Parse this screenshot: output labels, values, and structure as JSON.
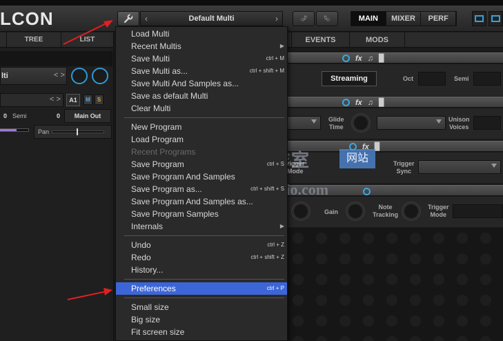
{
  "app": {
    "logo": "LCON",
    "multi_name": "Default Multi",
    "view_tabs": [
      "MAIN",
      "MIXER",
      "PERF"
    ],
    "active_view": "MAIN"
  },
  "left": {
    "tabs": [
      "",
      "TREE",
      "LIST"
    ],
    "program_name": "lti",
    "arrows": "< >",
    "part": "A1",
    "mute": "M",
    "solo": "S",
    "semi_value": "0",
    "semi_label": "Semi",
    "semi_value2": "0",
    "output": "Main Out",
    "pan_label": "Pan",
    "volume_level": 0.57
  },
  "right": {
    "tabs": [
      "EVENTS",
      "MODS"
    ],
    "streaming": "Streaming",
    "oct": "Oct",
    "semi": "Semi",
    "glide": "Glide\nTime",
    "unison": "Unison\nVoices",
    "trigger_mode": "rigger\nMode",
    "trigger_sync": "Trigger\nSync",
    "gain": "Gain",
    "note_tracking": "Note\nTracking",
    "trigger_mode2": "Trigger\nMode",
    "mode_clipped": "Mode",
    "accent_color": "#2f9ad8"
  },
  "menu": {
    "items": [
      {
        "label": "Load Multi",
        "shortcut": ""
      },
      {
        "label": "Recent Multis",
        "shortcut": "",
        "submenu": true
      },
      {
        "label": "Save Multi",
        "shortcut": "ctrl + M"
      },
      {
        "label": "Save Multi as...",
        "shortcut": "ctrl + shift + M"
      },
      {
        "label": "Save Multi And Samples as...",
        "shortcut": ""
      },
      {
        "label": "Save as default Multi",
        "shortcut": ""
      },
      {
        "label": "Clear Multi",
        "shortcut": ""
      },
      {
        "label": "New Program",
        "shortcut": ""
      },
      {
        "label": "Load Program",
        "shortcut": ""
      },
      {
        "label": "Recent Programs",
        "shortcut": "",
        "disabled": true
      },
      {
        "label": "Save Program",
        "shortcut": "ctrl + S"
      },
      {
        "label": "Save Program And Samples",
        "shortcut": ""
      },
      {
        "label": "Save Program as...",
        "shortcut": "ctrl + shift + S"
      },
      {
        "label": "Save Program And Samples as...",
        "shortcut": ""
      },
      {
        "label": "Save Program Samples",
        "shortcut": ""
      },
      {
        "label": "Internals",
        "shortcut": "",
        "submenu": true
      },
      {
        "label": "Undo",
        "shortcut": "ctrl + Z"
      },
      {
        "label": "Redo",
        "shortcut": "ctrl + shift + Z"
      },
      {
        "label": "History...",
        "shortcut": ""
      },
      {
        "label": "Preferences",
        "shortcut": "ctrl + P",
        "selected": true
      },
      {
        "label": "Small size",
        "shortcut": ""
      },
      {
        "label": "Big size",
        "shortcut": ""
      },
      {
        "label": "Fit screen size",
        "shortcut": ""
      }
    ],
    "highlight_color": "#3c66d8"
  },
  "watermark": {
    "cn": "腾龙工作室",
    "box": "网站",
    "en": "Tenlonstudio.com"
  }
}
